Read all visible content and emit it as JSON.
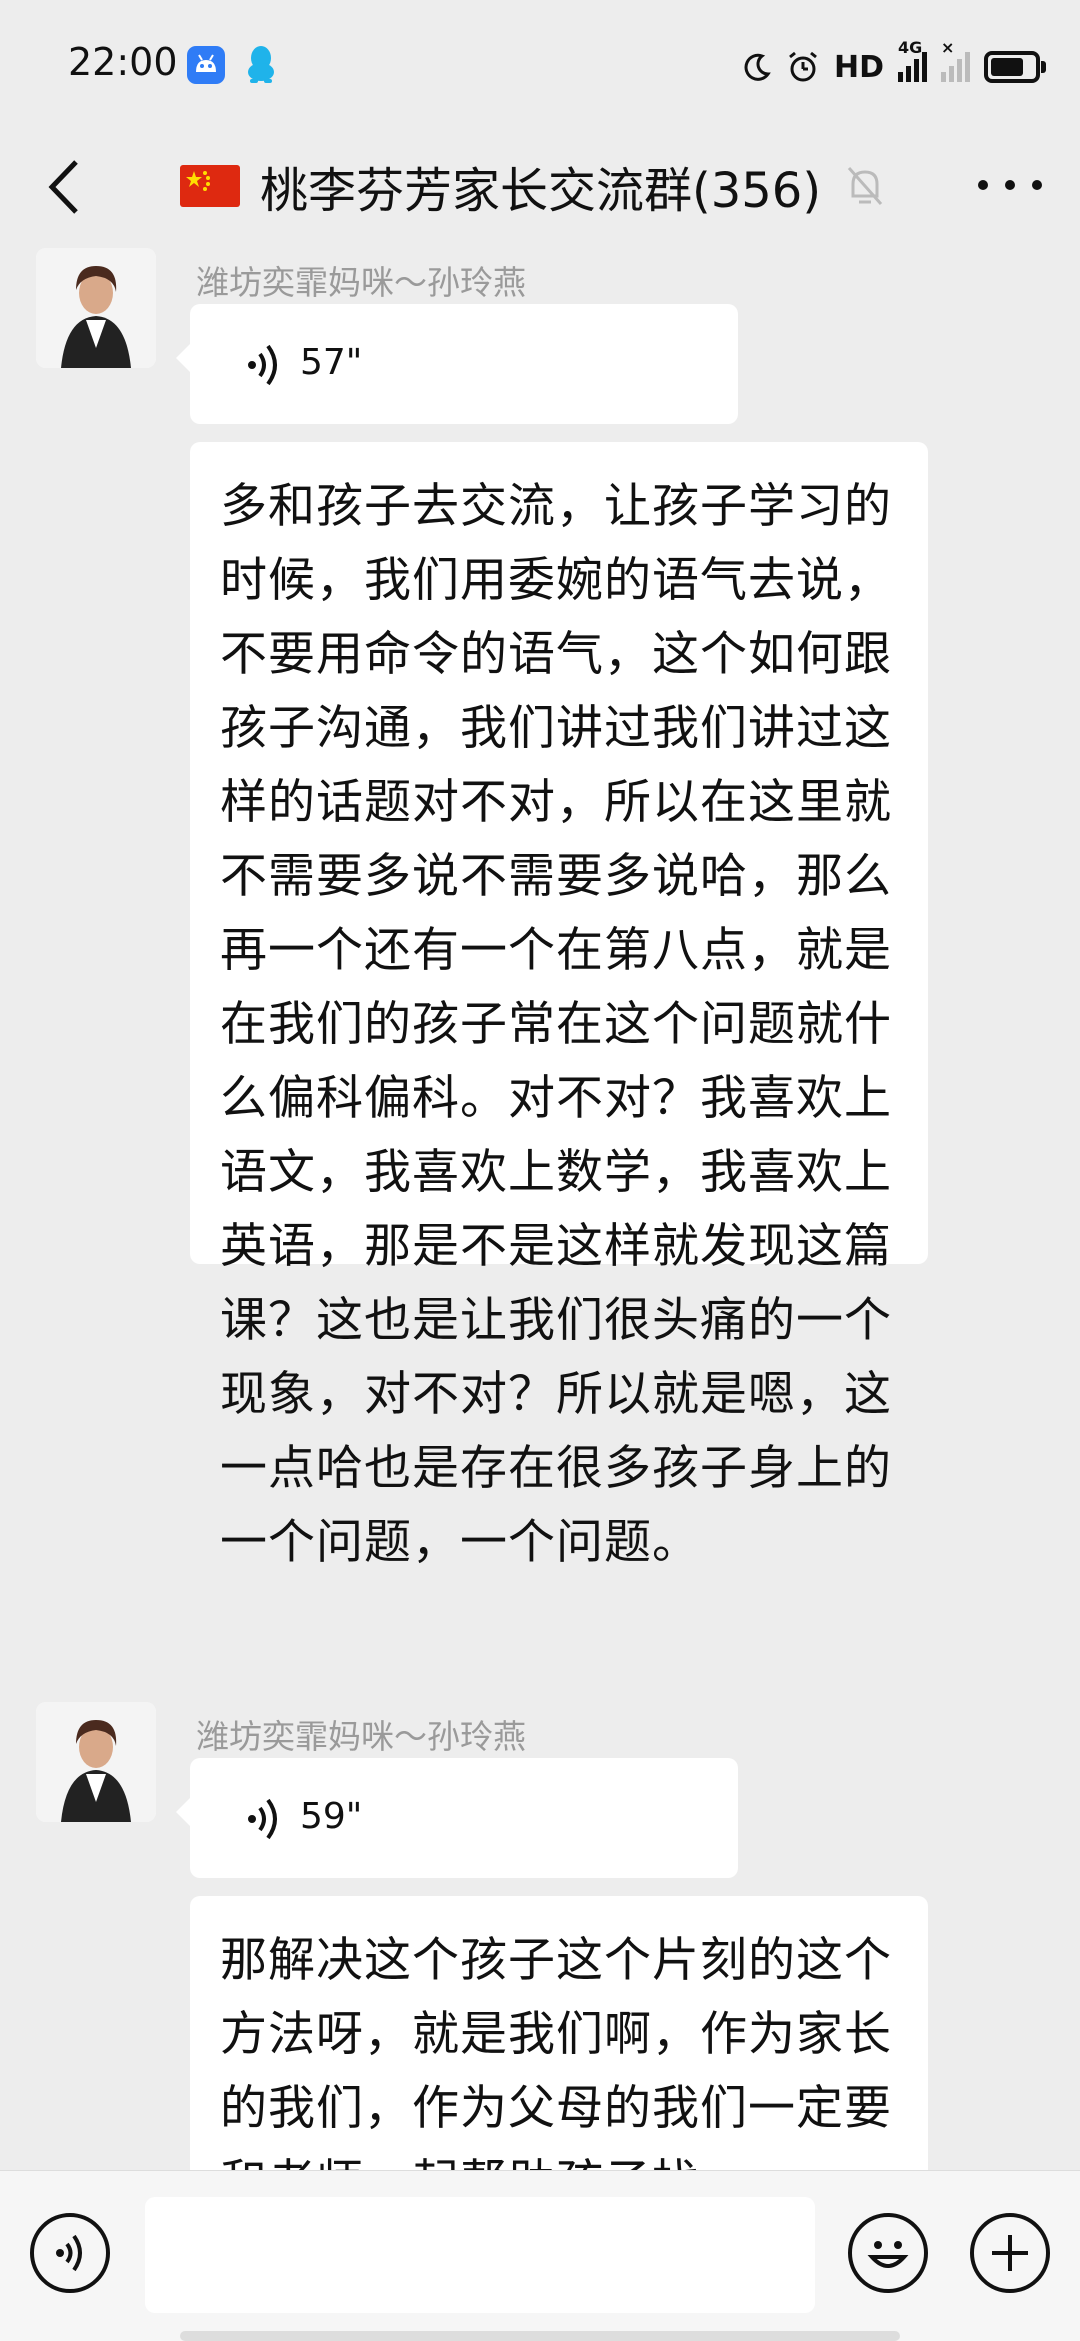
{
  "status_bar": {
    "time": "22:00",
    "network_label": "HD",
    "signal1_label": "4G",
    "signal2_label": "×",
    "icons": [
      "android-app-icon",
      "qq-penguin-icon",
      "moon-icon",
      "alarm-icon",
      "signal-icon",
      "battery-icon"
    ]
  },
  "header": {
    "title": "桃李芬芳家长交流群(356)",
    "flag": "china-flag",
    "muted": true
  },
  "messages": [
    {
      "sender": "潍坊奕霏妈咪～孙玲燕",
      "voice_duration": "57\"",
      "text": "多和孩子去交流，让孩子学习的时候，我们用委婉的语气去说，不要用命令的语气，这个如何跟孩子沟通，我们讲过我们讲过这样的话题对不对，所以在这里就不需要多说不需要多说哈，那么再一个还有一个在第八点，就是在我们的孩子常在这个问题就什么偏科偏科。对不对？我喜欢上语文，我喜欢上数学，我喜欢上英语，那是不是这样就发现这篇课？这也是让我们很头痛的一个现象，对不对？所以就是嗯，这一点哈也是存在很多孩子身上的一个问题，一个问题。"
    },
    {
      "sender": "潍坊奕霏妈咪～孙玲燕",
      "voice_duration": "59\"",
      "text": "那解决这个孩子这个片刻的这个方法呀，就是我们啊，作为家长的我们，作为父母的我们一定要和老师一起帮助孩子找"
    }
  ],
  "input_bar": {
    "placeholder": ""
  },
  "colors": {
    "background": "#ededed",
    "bubble": "#ffffff",
    "sender_name": "#9a9a9a",
    "flag_red": "#de2910"
  }
}
